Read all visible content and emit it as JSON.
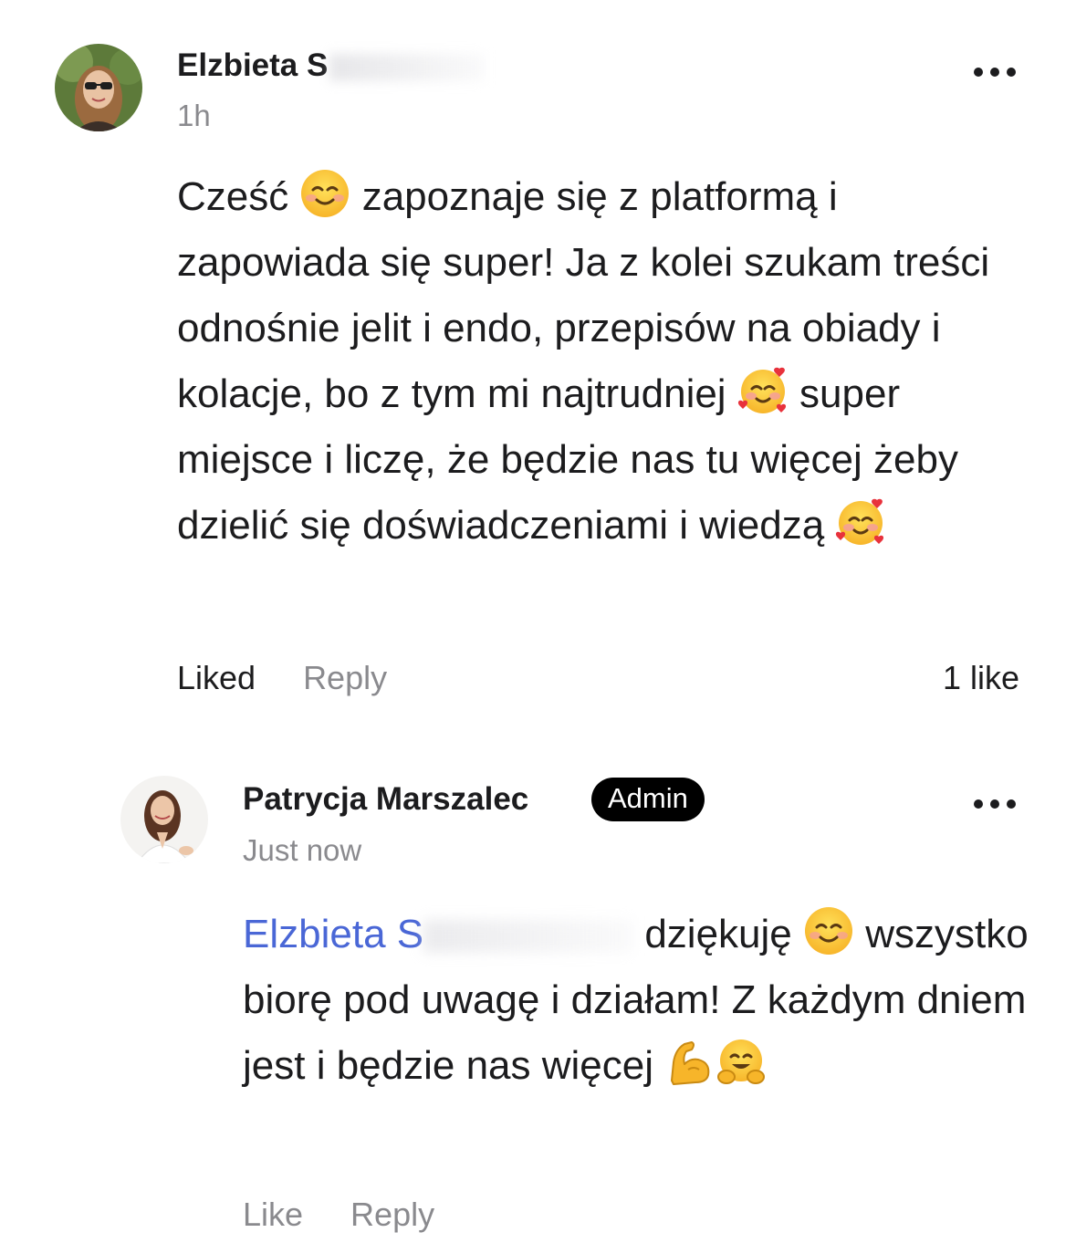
{
  "comments": [
    {
      "author": "Elzbieta S",
      "time": "1h",
      "body_parts": [
        "Cześć ",
        " zapoznaje się z platformą i zapowiada się super! Ja z kolei szukam treści odnośnie jelit i endo, przepisów na obiady i kolacje, bo z tym mi najtrudniej ",
        " super miejsce i liczę, że będzie nas tu więcej żeby dzielić się doświadczeniami i wiedzą "
      ],
      "emojis": [
        "smiling-face-emoji",
        "smiling-face-with-hearts-emoji",
        "smiling-face-with-hearts-emoji"
      ],
      "actions": {
        "like": "Liked",
        "reply": "Reply"
      },
      "like_count": "1 like"
    },
    {
      "author": "Patrycja Marszalec",
      "badge": "Admin",
      "time": "Just now",
      "mention": "Elzbieta S",
      "body_parts": [
        " dziękuję ",
        " wszystko biorę pod uwagę i działam! Z każdym dniem jest i będzie nas więcej "
      ],
      "emojis": [
        "smiling-face-emoji",
        "flexed-biceps-emoji",
        "hugging-face-emoji"
      ],
      "actions": {
        "like": "Like",
        "reply": "Reply"
      }
    }
  ],
  "colors": {
    "text": "#1c1c1e",
    "secondary": "#8a8a8e",
    "mention": "#4a67d6",
    "badge_bg": "#000000"
  }
}
